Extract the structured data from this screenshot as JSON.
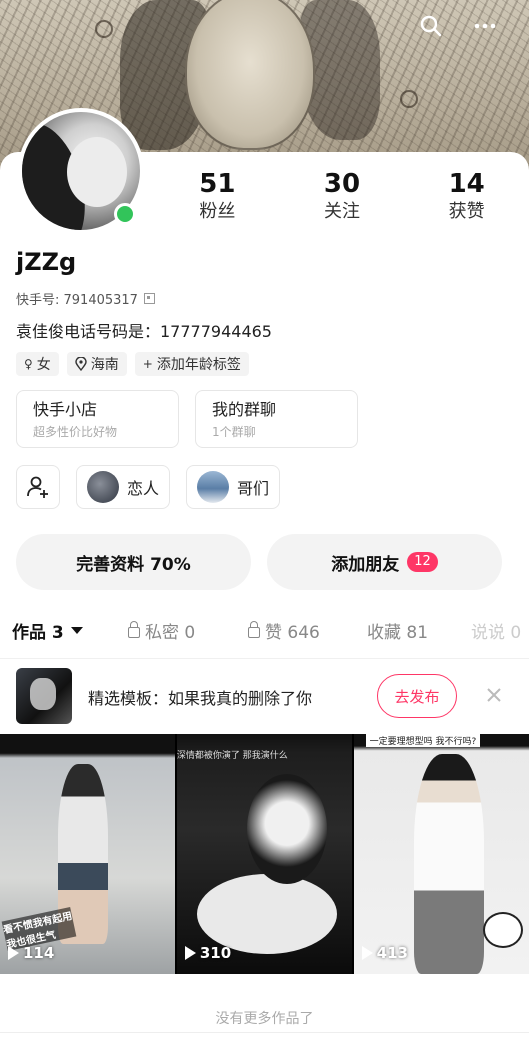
{
  "header": {
    "icons": [
      "search-icon",
      "more-icon"
    ]
  },
  "profile": {
    "username": "jZZg",
    "kuaishou_id_label": "快手号: 791405317",
    "bio": "袁佳俊电话号码是：17777944465",
    "online": true
  },
  "stats": [
    {
      "value": "51",
      "label": "粉丝"
    },
    {
      "value": "30",
      "label": "关注"
    },
    {
      "value": "14",
      "label": "获赞"
    }
  ],
  "tags": [
    {
      "icon": "female-icon",
      "label": "女"
    },
    {
      "icon": "location-icon",
      "label": "海南"
    },
    {
      "icon": "plus-icon",
      "label": "添加年龄标签"
    }
  ],
  "cards": [
    {
      "title": "快手小店",
      "subtitle": "超多性价比好物"
    },
    {
      "title": "我的群聊",
      "subtitle": "1个群聊"
    }
  ],
  "friends": [
    {
      "label": "恋人"
    },
    {
      "label": "哥们"
    }
  ],
  "actions": {
    "complete_profile": "完善资料 70%",
    "add_friend": "添加朋友",
    "add_friend_badge": "12"
  },
  "tabs": [
    {
      "label": "作品 3",
      "active": true
    },
    {
      "label": "私密 0",
      "locked": true
    },
    {
      "label": "赞 646",
      "locked": true
    },
    {
      "label": "收藏 81"
    },
    {
      "label": "说说 0"
    }
  ],
  "template_banner": {
    "text": "精选模板：如果我真的删除了你",
    "button": "去发布"
  },
  "works": [
    {
      "caption": "看不惯我有起用 我也很生气",
      "plays": "114"
    },
    {
      "caption": "深情都被你演了 那我演什么",
      "plays": "310"
    },
    {
      "caption": "一定要理想型吗 我不行吗?",
      "plays": "413"
    }
  ],
  "footer": {
    "no_more": "没有更多作品了"
  },
  "colors": {
    "accent": "#fe3666",
    "online": "#32c45a"
  }
}
